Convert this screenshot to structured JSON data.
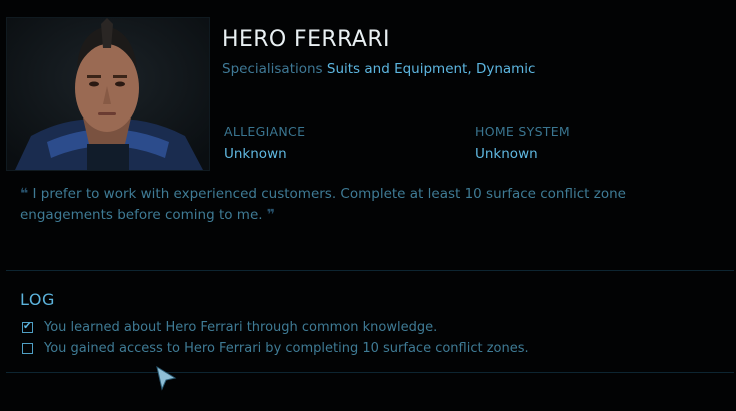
{
  "contact": {
    "name": "HERO FERRARI",
    "specialisations_label": "Specialisations",
    "specialisations_value": "Suits and Equipment, Dynamic",
    "allegiance_label": "ALLEGIANCE",
    "allegiance_value": "Unknown",
    "home_system_label": "HOME SYSTEM",
    "home_system_value": "Unknown"
  },
  "quote": {
    "open_mark": "❝",
    "text": "I prefer to work with experienced customers. Complete at least 10 surface conflict zone engagements before coming to me.",
    "close_mark": "❞"
  },
  "log": {
    "title": "LOG",
    "entries": [
      {
        "text": "You learned about Hero Ferrari through common knowledge.",
        "checked": true
      },
      {
        "text": "You gained access to Hero Ferrari by completing 10 surface conflict zones.",
        "checked": false
      }
    ]
  },
  "colors": {
    "background": "#020304",
    "name_text": "#e9f0f3",
    "accent": "#5db6e0",
    "muted": "#3f7b95"
  },
  "icons": {
    "portrait": "contact-portrait",
    "checked": "checkbox-checked-icon",
    "unchecked": "checkbox-empty-icon",
    "cursor": "mouse-pointer-icon"
  }
}
